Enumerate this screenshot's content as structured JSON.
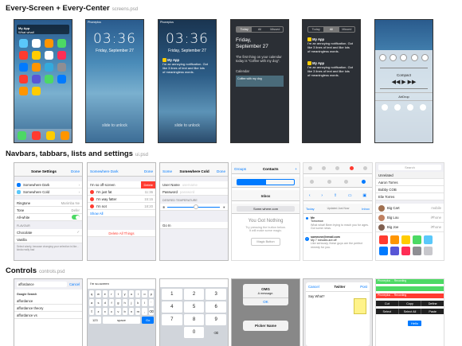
{
  "sections": {
    "s1": {
      "title": "Every-Screen + Every-Center",
      "file": "screens.psd"
    },
    "s2": {
      "title": "Navbars, tabbars, lists and settings",
      "file": "ui.psd"
    },
    "s3": {
      "title": "Controls",
      "file": "controls.psd"
    }
  },
  "carrier": "Phoneplus",
  "lock": {
    "time": "03:36",
    "date": "Friday, September 27",
    "slide": "slide to unlock"
  },
  "notif": {
    "app": "My App",
    "line1": "I'm an annoying notification. Got",
    "line2": "like 3 lines of text and like lots",
    "line3": "of meaningless words."
  },
  "home_preview": {
    "app": "My App",
    "text": "What what!"
  },
  "nc": {
    "tabs": [
      "Today",
      "All",
      "Missed"
    ],
    "date": "Friday,\nSeptember 27",
    "text": "The first thing on your calendar today is \"Coffee with my dog\".",
    "calendar": "Calendar",
    "event": "Coffee with my dog"
  },
  "cc": {
    "song": "Compact",
    "airdrop": "AirDrop"
  },
  "settings": {
    "title": "Some Settings",
    "done": "Done",
    "rows": [
      "Somewhere Dark",
      "Somewhere Cold"
    ],
    "ringtone": "Ringtone",
    "ringtone_val": "Marimba Ne",
    "tone": "Tone",
    "tone_val": "Defer",
    "all_white": "All-white",
    "flavour_h": "FLAVOUR",
    "flavours": [
      "Chocolate",
      "Vanilla"
    ],
    "footer": "Select wisely, because changing your selection is like... kinda really bad"
  },
  "list_edit": {
    "back": "Somewhere Dark",
    "done": "Done",
    "first": "I'm so off-screen",
    "delete": "Delete",
    "rows": [
      "I'm just fat",
      "I'm way fatter",
      "I'm not"
    ],
    "times": [
      "11:36",
      "15:15",
      "18:20"
    ],
    "show_all": "Show All",
    "delete_all": "Delete All Things"
  },
  "form": {
    "back": "Some",
    "title": "Somewhere Cold",
    "done": "Done",
    "user": "User Name",
    "user_ph": "username",
    "pass": "Password",
    "pass_ph": "password",
    "temp_h": "DESIRED TEMPERATURE",
    "go": "Go In"
  },
  "contacts": {
    "groups": "Groups",
    "title": "Contacts",
    "add": "+"
  },
  "navs": {
    "inbox": "Inbox",
    "url": "Some.where.com",
    "got_title": "You Got Nothing",
    "got_text": "Try pressing the button below.\nIt will make some magic.",
    "magic": "Magic Button",
    "today": "Today",
    "seg": [
      "Updated Just Now"
    ],
    "mail1_from": "Me",
    "mail1_subj": "Tomorrow",
    "mail1_text": "What what! Been trying to reach you for ages. Got some news.",
    "mail2_from": "someone@email.com",
    "mail2_subj": "My 7 minutes are off",
    "mail2_text": "Like seriously, these guys are the perfect remedy for you."
  },
  "people": {
    "search": "Search",
    "h": "Unrelated",
    "names": [
      "Aaron Torres",
      "Bobby COB",
      "Elie Torres"
    ],
    "contacts": [
      "Big Cart",
      "Big Lou",
      "Big Joe"
    ],
    "labels": [
      "mobile",
      "iPhone",
      "iPhone"
    ]
  },
  "controls": {
    "search_val": "affordance",
    "cancel": "Cancel",
    "google": "Google Search",
    "suggest": [
      "affordance",
      "affordance theory",
      "affordance vs"
    ],
    "kb_top": "I'm so-screen",
    "space": "space",
    "go": "Go",
    "alert_title": "OMG",
    "alert_msg": "A message.",
    "alert_ok": "OK",
    "picker": "Picker Name",
    "tw_cancel": "Cancel",
    "tw_title": "Twitter",
    "tw_post": "Post",
    "tw_text": "Say What?",
    "bar_text": "Phoneplus ... Recording",
    "menu": [
      "Cut",
      "Copy",
      "Define",
      "Select",
      "Select All",
      "Paste"
    ],
    "hello": "Hello"
  },
  "colors": {
    "ios_blue": "#007aff",
    "red": "#ff3b30",
    "green": "#4cd964"
  }
}
